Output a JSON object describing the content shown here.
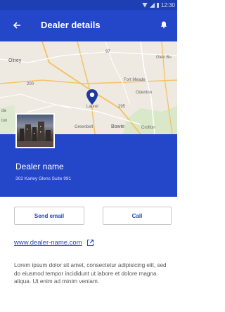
{
  "status_bar": {
    "time": "12:30"
  },
  "app_bar": {
    "title": "Dealer details"
  },
  "map": {
    "labels": {
      "olney": "Olney",
      "glen_burnie": "Glen Bu",
      "route_200": "200",
      "route_97": "97",
      "route_295": "295",
      "fort_meade": "Fort Meade",
      "odenton": "Odenton",
      "laurel": "Laurel",
      "greenbelt": "Greenbelt",
      "bowie": "Bowie",
      "crofton": "Crofton",
      "da": "da",
      "ton": "ton"
    }
  },
  "dealer": {
    "name": "Dealer name",
    "address": "302 Karley Glens Suite 991"
  },
  "actions": {
    "send_email": "Send email",
    "call": "Call"
  },
  "website": {
    "link": "www.dealer-name.com"
  },
  "description": "Lorem ipsum dolor sit amet, consectetur adipisicing elit, sed do eiusmod tempor incididunt ut labore et dolore magna aliqua. Ut enim ad minim veniam.",
  "colors": {
    "primary": "#2446c8",
    "status_bar": "#1e3fb4"
  }
}
